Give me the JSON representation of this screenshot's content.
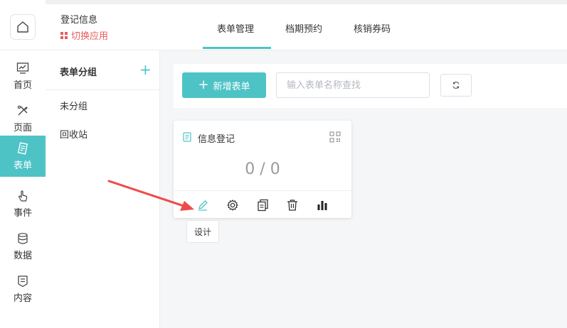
{
  "sidebar": {
    "items": [
      {
        "label": "首页",
        "icon": "chart-monitor-icon"
      },
      {
        "label": "页面",
        "icon": "design-tools-icon"
      },
      {
        "label": "表单",
        "icon": "form-icon"
      },
      {
        "label": "事件",
        "icon": "hand-pointer-icon"
      },
      {
        "label": "数据",
        "icon": "database-icon"
      },
      {
        "label": "内容",
        "icon": "content-doc-icon"
      }
    ],
    "active_index": 2,
    "accent": "#4ec3c6"
  },
  "header": {
    "app_name": "登记信息",
    "switch_app": "切换应用",
    "tabs": [
      "表单管理",
      "档期预约",
      "核销券码"
    ],
    "active_tab": 0
  },
  "groups": {
    "title": "表单分组",
    "add": "+",
    "items": [
      "未分组",
      "回收站"
    ]
  },
  "toolbar": {
    "new_form": "新增表单",
    "search_placeholder": "输入表单名称查找"
  },
  "card": {
    "title": "信息登记",
    "count": "0 / 0",
    "actions": [
      "edit-pencil-icon",
      "settings-gear-icon",
      "copy-icon",
      "trash-icon",
      "bar-chart-icon"
    ]
  },
  "tooltip": "设计",
  "colors": {
    "accent": "#4ec3c6",
    "switch": "#e65d5d",
    "arrow": "#f04a4a"
  }
}
